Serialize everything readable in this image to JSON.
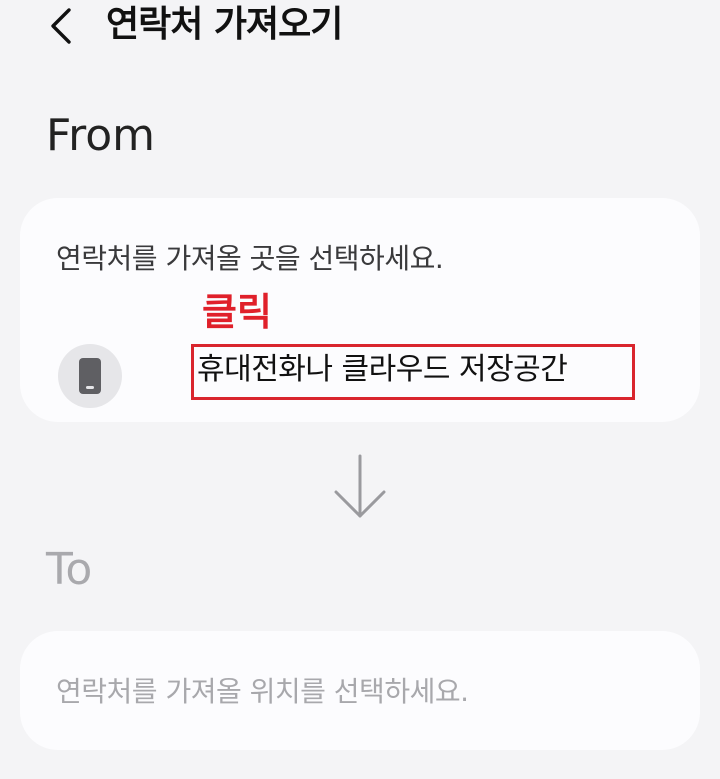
{
  "header": {
    "title": "연락처 가져오기"
  },
  "from": {
    "label": "From",
    "prompt": "연락처를 가져올 곳을 선택하세요.",
    "annotation": "클릭",
    "source_option": "휴대전화나 클라우드 저장공간"
  },
  "to": {
    "label": "To",
    "prompt": "연락처를 가져올 위치를 선택하세요."
  },
  "colors": {
    "background": "#f4f4f6",
    "card": "#fcfcfe",
    "annotation_red": "#e0202a",
    "disabled_text": "#a8a8ac"
  }
}
